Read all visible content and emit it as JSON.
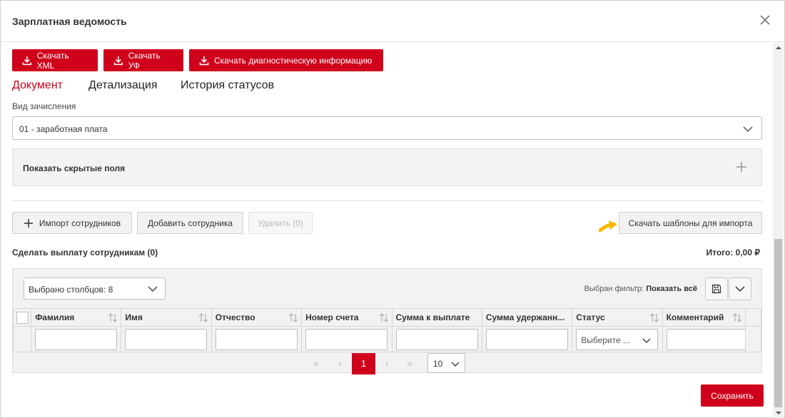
{
  "modal": {
    "title": "Зарплатная ведомость"
  },
  "toolbar": {
    "download_xml": "Скачать XML",
    "download_uf": "Скачать УФ",
    "download_diag": "Скачать диагностическую информацию"
  },
  "tabs": [
    {
      "label": "Документ",
      "active": true
    },
    {
      "label": "Детализация",
      "active": false
    },
    {
      "label": "История статусов",
      "active": false
    }
  ],
  "accrual": {
    "label": "Вид зачисления",
    "value": "01 - заработная плата"
  },
  "hidden_fields": {
    "label": "Показать скрытые поля"
  },
  "actions": {
    "import_employees": "Импорт сотрудников",
    "add_employee": "Добавить сотрудника",
    "delete": "Удалить (0)",
    "download_templates": "Скачать шаблоны для импорта"
  },
  "payout": {
    "title": "Сделать выплату сотрудникам (0)",
    "total": "Итого: 0,00 ₽"
  },
  "grid": {
    "columns_selected": "Выбрано столбцов: 8",
    "filter_label": "Выбран фильтр: ",
    "filter_value": "Показать всё",
    "columns": [
      "Фамилия",
      "Имя",
      "Отчество",
      "Номер счета",
      "Сумма к выплате",
      "Сумма удержанн...",
      "Статус",
      "Комментарий"
    ],
    "status_placeholder": "Выберите ...",
    "pager": {
      "current_page": "1",
      "page_size": "10"
    }
  },
  "footer": {
    "save_label": "Сохранить"
  },
  "colors": {
    "accent": "#d0021b",
    "pointer": "#f5b800"
  }
}
